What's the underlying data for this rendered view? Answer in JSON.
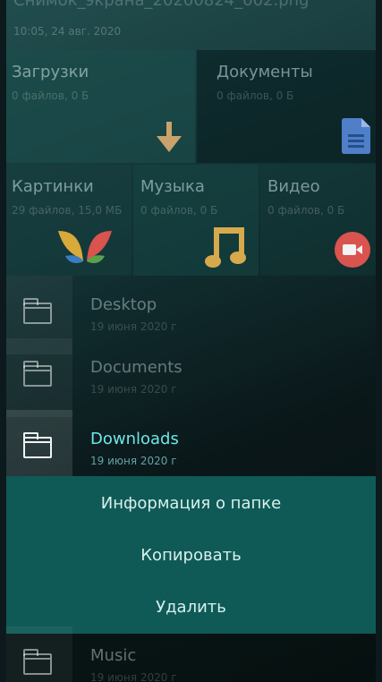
{
  "recent_file": {
    "name": "Снимок_экрана_20200824_002.png",
    "meta": "10:05, 24 авг. 2020"
  },
  "categories": [
    {
      "label": "Загрузки",
      "count": "0 файлов, 0 Б",
      "icon": "download-arrow-icon",
      "color": "#c9a36b"
    },
    {
      "label": "Документы",
      "count": "0 файлов, 0 Б",
      "icon": "document-icon",
      "color": "#4f7fc9"
    },
    {
      "label": "Картинки",
      "count": "29 файлов, 15,0 МБ",
      "icon": "butterfly-icon",
      "color": "#d9a93a"
    },
    {
      "label": "Музыка",
      "count": "0 файлов, 0 Б",
      "icon": "music-note-icon",
      "color": "#d7a94d"
    },
    {
      "label": "Видео",
      "count": "0 файлов, 0 Б",
      "icon": "video-camera-icon",
      "color": "#d9534f"
    }
  ],
  "folders": [
    {
      "name": "Desktop",
      "date": "19 июня 2020 г"
    },
    {
      "name": "Documents",
      "date": "19 июня 2020 г"
    },
    {
      "name": "Downloads",
      "date": "19 июня 2020 г"
    },
    {
      "name": "Music",
      "date": "19 июня 2020 г"
    }
  ],
  "context_menu": {
    "items": [
      "Информация о папке",
      "Копировать",
      "Удалить"
    ]
  },
  "colors": {
    "highlight": "#6ee6e6",
    "menu_background": "#0f5a56"
  }
}
